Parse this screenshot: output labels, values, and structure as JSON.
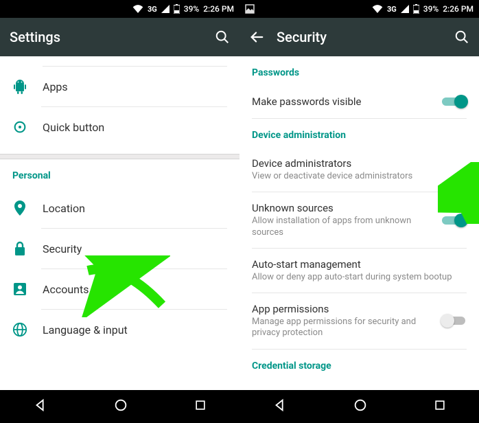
{
  "status": {
    "network": "3G",
    "battery": "39%",
    "time": "2:26 PM"
  },
  "left": {
    "title": "Settings",
    "items_top": [
      {
        "icon": "android-icon",
        "label": "Apps"
      },
      {
        "icon": "quick-icon",
        "label": "Quick button"
      }
    ],
    "section": "Personal",
    "items": [
      {
        "icon": "location-icon",
        "label": "Location"
      },
      {
        "icon": "lock-icon",
        "label": "Security"
      },
      {
        "icon": "accounts-icon",
        "label": "Accounts"
      },
      {
        "icon": "globe-icon",
        "label": "Language & input"
      }
    ]
  },
  "right": {
    "title": "Security",
    "sections": {
      "passwords_header": "Passwords",
      "make_passwords_visible": "Make passwords visible",
      "device_admin_header": "Device administration",
      "device_admin": {
        "title": "Device administrators",
        "sub": "View or deactivate device administrators"
      },
      "unknown": {
        "title": "Unknown sources",
        "sub": "Allow installation of apps from unknown sources"
      },
      "autostart": {
        "title": "Auto-start management",
        "sub": "Allow or deny app auto-start during system bootup"
      },
      "appperm": {
        "title": "App permissions",
        "sub": "Manage app permissions for security and privacy protection"
      },
      "cred_header": "Credential storage"
    }
  }
}
